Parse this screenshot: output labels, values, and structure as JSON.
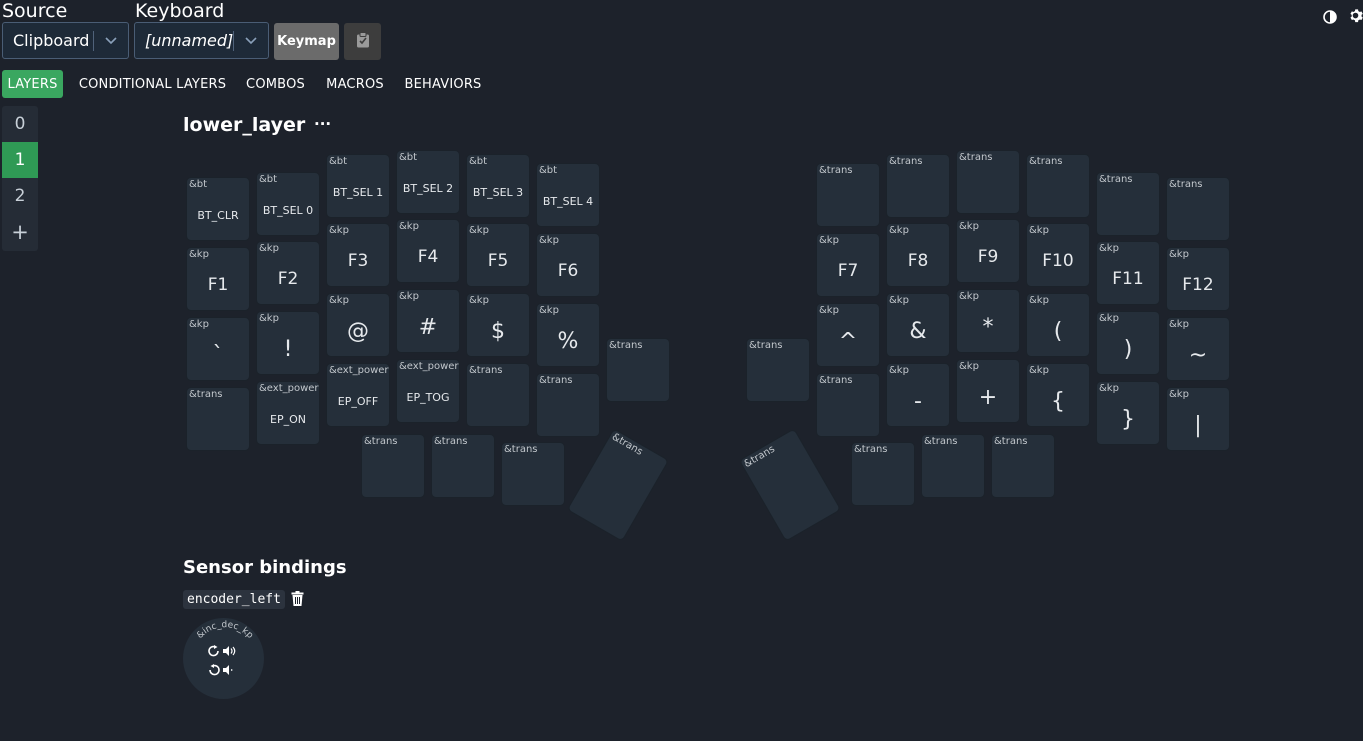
{
  "header": {
    "source_label": "Source",
    "keyboard_label": "Keyboard",
    "source_value": "Clipboard",
    "keyboard_value": "[unnamed]",
    "keymap_button": "Keymap"
  },
  "tabs": [
    "LAYERS",
    "CONDITIONAL LAYERS",
    "COMBOS",
    "MACROS",
    "BEHAVIORS"
  ],
  "layers": [
    "0",
    "1",
    "2",
    "+"
  ],
  "active_layer": "1",
  "layer_title": "lower_layer",
  "layer_menu": "···",
  "keys": [
    {
      "b": "&bt",
      "p": "BT_CLR"
    },
    {
      "b": "&bt",
      "p": "BT_SEL 0"
    },
    {
      "b": "&bt",
      "p": "BT_SEL 1"
    },
    {
      "b": "&bt",
      "p": "BT_SEL 2"
    },
    {
      "b": "&bt",
      "p": "BT_SEL 3"
    },
    {
      "b": "&bt",
      "p": "BT_SEL 4"
    },
    {
      "b": "&trans",
      "p": ""
    },
    {
      "b": "&trans",
      "p": ""
    },
    {
      "b": "&trans",
      "p": ""
    },
    {
      "b": "&trans",
      "p": ""
    },
    {
      "b": "&trans",
      "p": ""
    },
    {
      "b": "&trans",
      "p": ""
    },
    {
      "b": "&kp",
      "p": "F1"
    },
    {
      "b": "&kp",
      "p": "F2"
    },
    {
      "b": "&kp",
      "p": "F3"
    },
    {
      "b": "&kp",
      "p": "F4"
    },
    {
      "b": "&kp",
      "p": "F5"
    },
    {
      "b": "&kp",
      "p": "F6"
    },
    {
      "b": "&kp",
      "p": "F7"
    },
    {
      "b": "&kp",
      "p": "F8"
    },
    {
      "b": "&kp",
      "p": "F9"
    },
    {
      "b": "&kp",
      "p": "F10"
    },
    {
      "b": "&kp",
      "p": "F11"
    },
    {
      "b": "&kp",
      "p": "F12"
    },
    {
      "b": "&kp",
      "p": "`"
    },
    {
      "b": "&kp",
      "p": "!"
    },
    {
      "b": "&kp",
      "p": "@"
    },
    {
      "b": "&kp",
      "p": "#"
    },
    {
      "b": "&kp",
      "p": "$"
    },
    {
      "b": "&kp",
      "p": "%"
    },
    {
      "b": "&trans",
      "p": ""
    },
    {
      "b": "&trans",
      "p": ""
    },
    {
      "b": "&kp",
      "p": "^"
    },
    {
      "b": "&kp",
      "p": "&"
    },
    {
      "b": "&kp",
      "p": "*"
    },
    {
      "b": "&kp",
      "p": "("
    },
    {
      "b": "&kp",
      "p": ")"
    },
    {
      "b": "&kp",
      "p": "~"
    },
    {
      "b": "&trans",
      "p": ""
    },
    {
      "b": "&ext_power",
      "p": "EP_ON"
    },
    {
      "b": "&ext_power",
      "p": "EP_OFF"
    },
    {
      "b": "&ext_power",
      "p": "EP_TOG"
    },
    {
      "b": "&trans",
      "p": ""
    },
    {
      "b": "&trans",
      "p": ""
    },
    {
      "b": "&trans",
      "p": ""
    },
    {
      "b": "&kp",
      "p": "-"
    },
    {
      "b": "&kp",
      "p": "+"
    },
    {
      "b": "&kp",
      "p": "{"
    },
    {
      "b": "&kp",
      "p": "}"
    },
    {
      "b": "&kp",
      "p": "|"
    },
    {
      "b": "&trans",
      "p": ""
    },
    {
      "b": "&trans",
      "p": ""
    },
    {
      "b": "&trans",
      "p": ""
    },
    {
      "b": "&trans",
      "p": ""
    },
    {
      "b": "&trans",
      "p": ""
    },
    {
      "b": "&trans",
      "p": ""
    },
    {
      "b": "&trans",
      "p": ""
    },
    {
      "b": "&trans",
      "p": ""
    }
  ],
  "sensor": {
    "title": "Sensor bindings",
    "encoder_name": "encoder_left",
    "binding": "&inc_dec_kp"
  }
}
